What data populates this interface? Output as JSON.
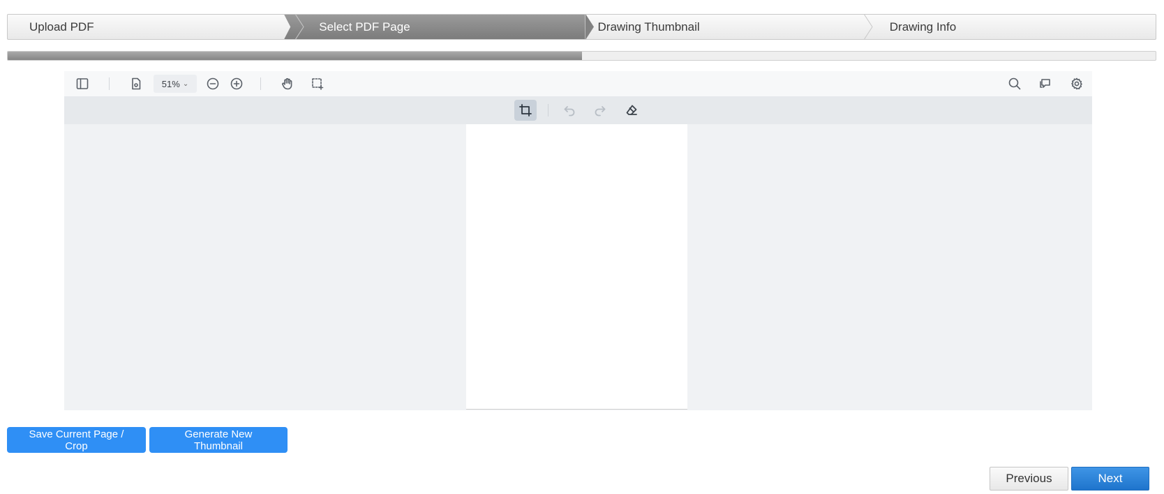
{
  "wizard": {
    "steps": [
      {
        "label": "Upload PDF",
        "active": false
      },
      {
        "label": "Select PDF Page",
        "active": true
      },
      {
        "label": "Drawing Thumbnail",
        "active": false
      },
      {
        "label": "Drawing Info",
        "active": false
      }
    ],
    "progress_percent": 50
  },
  "viewer": {
    "toolbar": {
      "icons": [
        "sidebar-toggle-icon",
        "page-settings-icon",
        "zoom-out-icon",
        "zoom-in-icon",
        "pan-hand-icon",
        "area-select-icon",
        "search-icon",
        "comments-icon",
        "settings-icon"
      ],
      "zoom_value": "51%"
    },
    "crop_toolbar": {
      "icons": [
        "crop-icon",
        "undo-icon",
        "redo-icon",
        "eraser-icon"
      ],
      "crop_active": true
    }
  },
  "actions": {
    "save_label": "Save Current Page / Crop",
    "generate_label": "Generate New Thumbnail"
  },
  "nav": {
    "previous_label": "Previous",
    "next_label": "Next"
  },
  "colors": {
    "primary_blue": "#2f8ff5",
    "active_step": "#8a8a8a",
    "next_button": "#2a7fd8"
  }
}
